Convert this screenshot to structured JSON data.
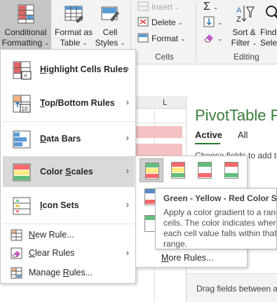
{
  "ribbon": {
    "conditional_formatting": {
      "line1": "Conditional",
      "line2": "Formatting",
      "chevron": "⌄"
    },
    "format_as_table": {
      "line1": "Format as",
      "line2": "Table",
      "chevron": "⌄"
    },
    "cell_styles": {
      "line1": "Cell",
      "line2": "Styles",
      "chevron": "⌄"
    },
    "insert_label": "Insert",
    "delete_label": "Delete",
    "format_label": "Format",
    "cells_group_label": "Cells",
    "sort_filter": {
      "line1": "Sort &",
      "line2": "Filter",
      "chevron": "⌄"
    },
    "find_select": {
      "line1": "Find",
      "line2": "Selec"
    },
    "editing_group_label": "Editing",
    "autosum_glyph": "Σ",
    "dropdown_chevron": "⌄"
  },
  "sheet": {
    "column_label": "L"
  },
  "pivot": {
    "title": "PivotTable Fi",
    "tabs": [
      "Active",
      "All"
    ],
    "subtitle": "Choose fields to add to",
    "drag_text": "Drag fields between ar"
  },
  "menu": {
    "items": [
      {
        "label": "Highlight Cells Rules",
        "underline_char": "H",
        "rest": "ighlight Cells Rules",
        "icon": "highlight-cells-icon",
        "has_submenu": true
      },
      {
        "label": "Top/Bottom Rules",
        "underline_char": "T",
        "rest": "op/Bottom Rules",
        "icon": "top-bottom-icon",
        "has_submenu": true
      },
      {
        "label": "Data Bars",
        "underline_char": "D",
        "rest": "ata Bars",
        "icon": "data-bars-icon",
        "has_submenu": true
      },
      {
        "label": "Color Scales",
        "prefix": "Color ",
        "underline_char": "S",
        "rest": "cales",
        "icon": "color-scales-icon",
        "has_submenu": true
      },
      {
        "label": "Icon Sets",
        "underline_char": "I",
        "rest": "con Sets",
        "icon": "icon-sets-icon",
        "has_submenu": true
      }
    ],
    "new_rule": {
      "underline_char": "N",
      "rest": "ew Rule..."
    },
    "clear_rules": {
      "underline_char": "C",
      "rest": "lear Rules"
    },
    "manage_rules": {
      "prefix": "Manage ",
      "underline_char": "R",
      "rest": "ules..."
    },
    "arrow_glyph": "›"
  },
  "color_scales_submenu": {
    "swatches": [
      {
        "name": "Green - Yellow - Red Color Scale",
        "colors": [
          "#63be7b",
          "#ffeb84",
          "#f8696b"
        ]
      },
      {
        "colors": [
          "#f8696b",
          "#ffeb84",
          "#63be7b"
        ]
      },
      {
        "colors": [
          "#63be7b",
          "#fcfcff",
          "#f8696b"
        ]
      },
      {
        "colors": [
          "#f8696b",
          "#fcfcff",
          "#63be7b"
        ]
      },
      {
        "colors": [
          "#5a8ac6",
          "#fcfcff",
          "#f8696b"
        ]
      },
      {
        "colors": [
          "#63be7b",
          "#fcfcff",
          "#fcfcff"
        ]
      }
    ],
    "more_rules": {
      "underline_char": "M",
      "rest": "ore Rules..."
    }
  },
  "tooltip": {
    "title": "Green - Yellow - Red Color Sc",
    "body": [
      "Apply a color gradient to a rang",
      "cells. The color indicates where",
      "each cell value falls within that",
      "range."
    ]
  },
  "colors": {
    "hover_bg": "#d9d9d9",
    "pivot_green": "#3a7d3a"
  }
}
